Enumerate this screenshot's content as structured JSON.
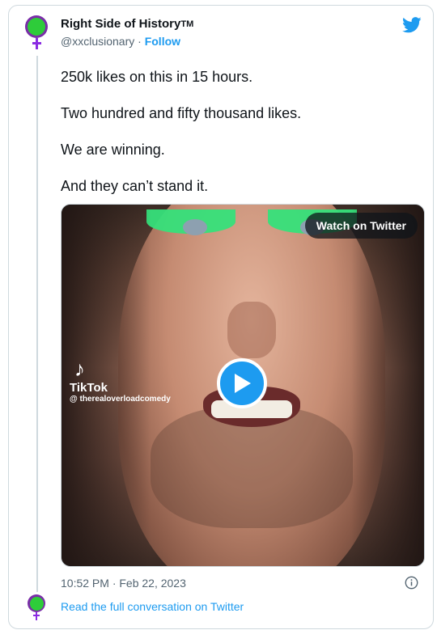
{
  "author": {
    "name": "Right Side of History",
    "trademark": "TM",
    "handle": "@xxclusionary",
    "separator": "·",
    "follow_label": "Follow"
  },
  "tweet": {
    "paragraphs": [
      "250k likes on this in 15 hours.",
      "Two hundred and fifty thousand likes.",
      "We are winning.",
      "And they can’t stand it."
    ]
  },
  "media": {
    "watch_label": "Watch on Twitter",
    "tiktok_name": "TikTok",
    "tiktok_handle": "@ therealoverloadcomedy"
  },
  "footer": {
    "timestamp": "10:52 PM · Feb 22, 2023",
    "read_link": "Read the full conversation on Twitter"
  },
  "colors": {
    "accent": "#1d9bf0",
    "text": "#0f1419",
    "secondary": "#536471",
    "avatar_ring": "#7a2da8",
    "avatar_fill": "#2ecc3a"
  },
  "icons": [
    "twitter-bird-icon",
    "play-icon",
    "info-icon",
    "tiktok-logo-icon",
    "female-symbol-icon"
  ]
}
